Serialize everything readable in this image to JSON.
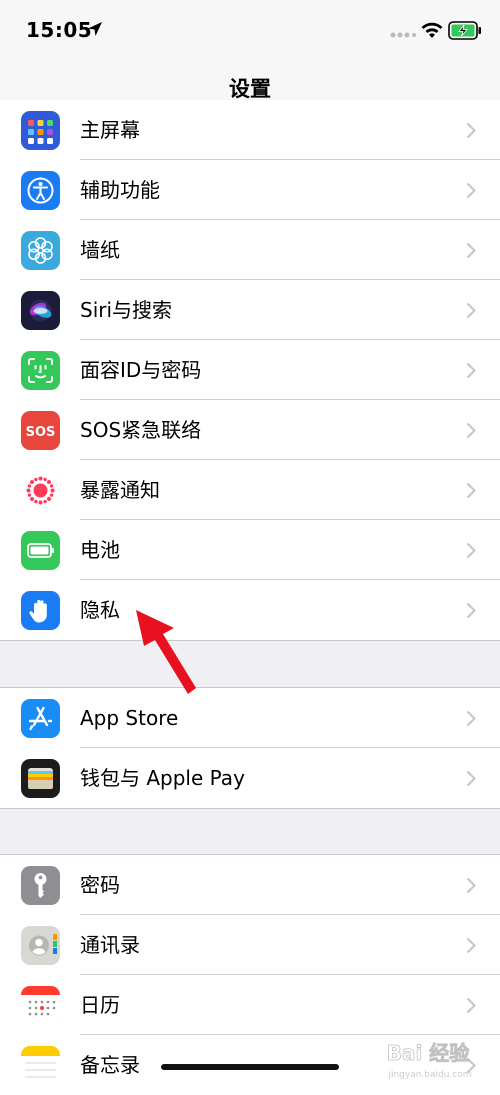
{
  "status_bar": {
    "time": "15:05"
  },
  "nav": {
    "title": "设置"
  },
  "groups": [
    {
      "items": [
        {
          "label": "主屏幕",
          "icon": "home-screen-icon",
          "color": "#2f5bd9"
        },
        {
          "label": "辅助功能",
          "icon": "accessibility-icon",
          "color": "#1a7cf5"
        },
        {
          "label": "墙纸",
          "icon": "wallpaper-flower-icon",
          "color": "#3aa9de"
        },
        {
          "label": "Siri与搜索",
          "icon": "siri-icon",
          "color": "#1b1b3a"
        },
        {
          "label": "面容ID与密码",
          "icon": "face-id-icon",
          "color": "#34c759"
        },
        {
          "label": "SOS紧急联络",
          "icon": "sos-icon",
          "color": "#e8453c"
        },
        {
          "label": "暴露通知",
          "icon": "exposure-notification-icon",
          "color": "#ffffff"
        },
        {
          "label": "电池",
          "icon": "battery-icon",
          "color": "#34c759"
        },
        {
          "label": "隐私",
          "icon": "privacy-hand-icon",
          "color": "#1a7cf5"
        }
      ]
    },
    {
      "items": [
        {
          "label": "App Store",
          "icon": "app-store-icon",
          "color": "#1a8cf5"
        },
        {
          "label": "钱包与 Apple Pay",
          "icon": "wallet-icon",
          "color": "#1c1c1e"
        }
      ]
    },
    {
      "items": [
        {
          "label": "密码",
          "icon": "key-icon",
          "color": "#8e8e93"
        },
        {
          "label": "通讯录",
          "icon": "contacts-icon",
          "color": "#d9d7d2"
        },
        {
          "label": "日历",
          "icon": "calendar-icon",
          "color": "#ffffff"
        },
        {
          "label": "备忘录",
          "icon": "notes-icon",
          "color": "#ffffff"
        }
      ]
    }
  ],
  "watermark": {
    "text": "Bai 经验",
    "sub": "jingyan.baidu.com"
  },
  "colors": {
    "accent": "#1a7cf5",
    "arrow": "#e8111f",
    "background": "#efeff4"
  }
}
